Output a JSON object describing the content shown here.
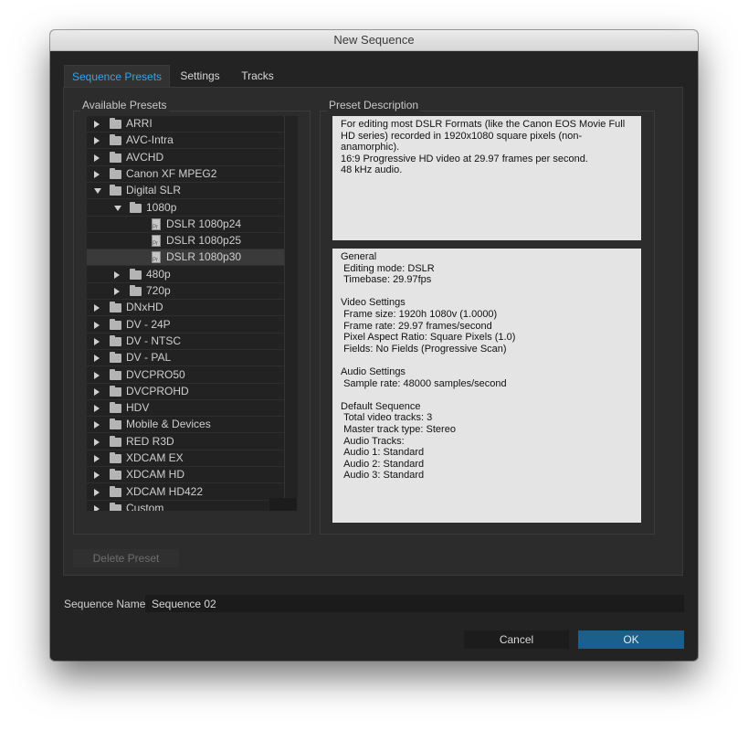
{
  "window": {
    "title": "New Sequence"
  },
  "tabs": [
    {
      "label": "Sequence Presets",
      "active": true
    },
    {
      "label": "Settings",
      "active": false
    },
    {
      "label": "Tracks",
      "active": false
    }
  ],
  "available_presets": {
    "title": "Available Presets",
    "items": [
      {
        "label": "ARRI",
        "type": "folder",
        "expanded": false,
        "level": 0
      },
      {
        "label": "AVC-Intra",
        "type": "folder",
        "expanded": false,
        "level": 0
      },
      {
        "label": "AVCHD",
        "type": "folder",
        "expanded": false,
        "level": 0
      },
      {
        "label": "Canon XF MPEG2",
        "type": "folder",
        "expanded": false,
        "level": 0
      },
      {
        "label": "Digital SLR",
        "type": "folder",
        "expanded": true,
        "level": 0
      },
      {
        "label": "1080p",
        "type": "folder",
        "expanded": true,
        "level": 1
      },
      {
        "label": "DSLR 1080p24",
        "type": "preset",
        "level": 2
      },
      {
        "label": "DSLR 1080p25",
        "type": "preset",
        "level": 2
      },
      {
        "label": "DSLR 1080p30",
        "type": "preset",
        "level": 2,
        "selected": true
      },
      {
        "label": "480p",
        "type": "folder",
        "expanded": false,
        "level": 1
      },
      {
        "label": "720p",
        "type": "folder",
        "expanded": false,
        "level": 1
      },
      {
        "label": "DNxHD",
        "type": "folder",
        "expanded": false,
        "level": 0
      },
      {
        "label": "DV - 24P",
        "type": "folder",
        "expanded": false,
        "level": 0
      },
      {
        "label": "DV - NTSC",
        "type": "folder",
        "expanded": false,
        "level": 0
      },
      {
        "label": "DV - PAL",
        "type": "folder",
        "expanded": false,
        "level": 0
      },
      {
        "label": "DVCPRO50",
        "type": "folder",
        "expanded": false,
        "level": 0
      },
      {
        "label": "DVCPROHD",
        "type": "folder",
        "expanded": false,
        "level": 0
      },
      {
        "label": "HDV",
        "type": "folder",
        "expanded": false,
        "level": 0
      },
      {
        "label": "Mobile & Devices",
        "type": "folder",
        "expanded": false,
        "level": 0
      },
      {
        "label": "RED R3D",
        "type": "folder",
        "expanded": false,
        "level": 0
      },
      {
        "label": "XDCAM EX",
        "type": "folder",
        "expanded": false,
        "level": 0
      },
      {
        "label": "XDCAM HD",
        "type": "folder",
        "expanded": false,
        "level": 0
      },
      {
        "label": "XDCAM HD422",
        "type": "folder",
        "expanded": false,
        "level": 0
      },
      {
        "label": "Custom",
        "type": "folder",
        "expanded": false,
        "level": 0
      }
    ]
  },
  "preset_description": {
    "title": "Preset Description",
    "summary": "For editing most DSLR Formats (like the Canon EOS Movie Full\nHD series) recorded in 1920x1080 square pixels (non-\nanamorphic).\n16:9 Progressive HD video at 29.97 frames per second.\n48 kHz audio.",
    "details": "General\n Editing mode: DSLR\n Timebase: 29.97fps\n\nVideo Settings\n Frame size: 1920h 1080v (1.0000)\n Frame rate: 29.97 frames/second\n Pixel Aspect Ratio: Square Pixels (1.0)\n Fields: No Fields (Progressive Scan)\n\nAudio Settings\n Sample rate: 48000 samples/second\n\nDefault Sequence\n Total video tracks: 3\n Master track type: Stereo\n Audio Tracks:\n Audio 1: Standard\n Audio 2: Standard\n Audio 3: Standard"
  },
  "buttons": {
    "delete_preset": "Delete Preset",
    "cancel": "Cancel",
    "ok": "OK"
  },
  "sequence_name": {
    "label": "Sequence Name:",
    "value": "Sequence 02"
  },
  "colors": {
    "accent": "#3fa0e0",
    "ok_button": "#1b5f8c",
    "dialog_bg": "#232323",
    "panel_bg": "#2c2c2c",
    "text_box_bg": "#e4e4e4"
  }
}
